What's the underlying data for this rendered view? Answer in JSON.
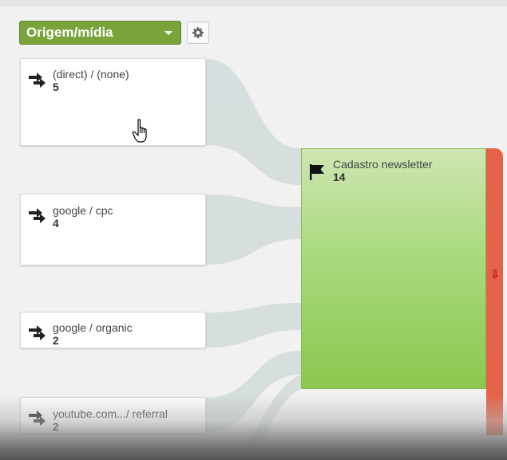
{
  "dimension_selector": {
    "label": "Origem/mídia"
  },
  "colors": {
    "selector_bg": "#7aa33b",
    "flow": "#d5dede",
    "goal_gradient_top": "#cfe6b3",
    "goal_gradient_bottom": "#8cc74f",
    "dropoff": "#e5624a"
  },
  "sources": [
    {
      "label": "(direct) / (none)",
      "count": "5",
      "icon": "traffic-arrows-icon"
    },
    {
      "label": "google / cpc",
      "count": "4",
      "icon": "traffic-arrows-icon"
    },
    {
      "label": "google / organic",
      "count": "2",
      "icon": "traffic-arrows-icon"
    },
    {
      "label": "youtube.com.../ referral",
      "count": "2",
      "icon": "traffic-arrows-icon"
    }
  ],
  "goal": {
    "label": "Cadastro newsletter",
    "count": "14",
    "icon": "flag-icon"
  },
  "dropoff": {
    "icon": "down-arrow-icon",
    "glyph": "⇩"
  }
}
